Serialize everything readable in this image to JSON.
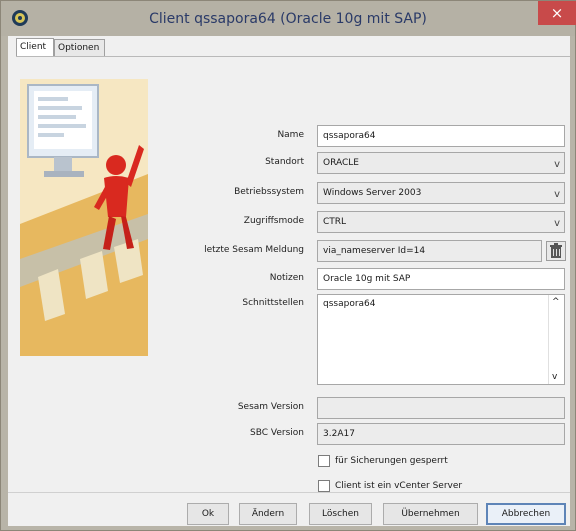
{
  "window": {
    "title": "Client qssapora64 (Oracle 10g mit SAP)",
    "close_glyph": "×"
  },
  "tabs": [
    "Client",
    "Optionen"
  ],
  "form": {
    "name": {
      "label": "Name",
      "value": "qssapora64"
    },
    "standort": {
      "label": "Standort",
      "value": "ORACLE"
    },
    "betriebssystem": {
      "label": "Betriebssystem",
      "value": "Windows Server 2003"
    },
    "zugriffsmode": {
      "label": "Zugriffsmode",
      "value": "CTRL"
    },
    "letzte_meldung": {
      "label": "letzte Sesam Meldung",
      "value": "via_nameserver Id=14"
    },
    "notizen": {
      "label": "Notizen",
      "value": "Oracle 10g mit SAP"
    },
    "schnittstellen": {
      "label": "Schnittstellen",
      "value": "qssapora64"
    },
    "sesam_version": {
      "label": "Sesam Version",
      "value": ""
    },
    "sbc_version": {
      "label": "SBC Version",
      "value": "3.2A17"
    },
    "checkbox_gesperrt": {
      "label": "für Sicherungen gesperrt",
      "checked": false
    },
    "checkbox_vcenter": {
      "label": "Client ist ein vCenter Server",
      "checked": false
    }
  },
  "buttons": {
    "ok": "Ok",
    "aendern": "Ändern",
    "loeschen": "Löschen",
    "uebernehmen": "Übernehmen",
    "abbrechen": "Abbrechen"
  },
  "icons": {
    "dropdown_chevron": "v",
    "scroll_up": "^",
    "scroll_down": "v"
  },
  "colors": {
    "titlebar": "#b5b1a5",
    "title_text": "#2a3a68",
    "close_button": "#c84a4a",
    "default_button_border": "#5e84b7",
    "side_image_bg": "#f6e7c2"
  }
}
